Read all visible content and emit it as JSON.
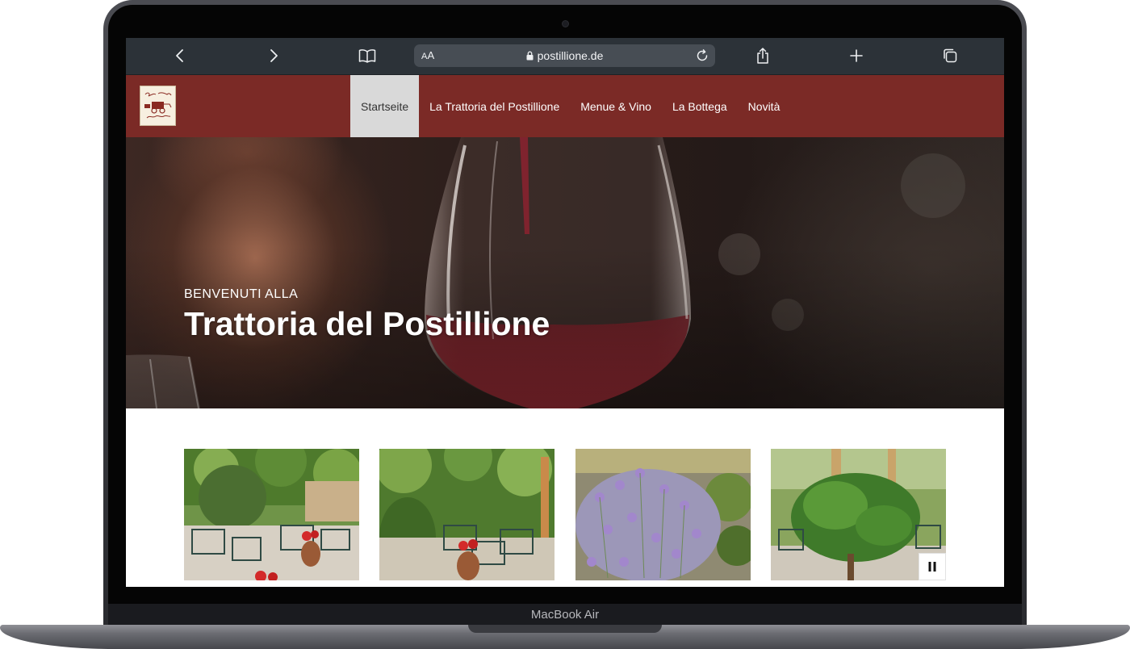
{
  "device": {
    "label": "MacBook Air"
  },
  "browser": {
    "url": "postillione.de",
    "aa_label_small": "A",
    "aa_label_big": "A"
  },
  "site": {
    "nav": [
      {
        "label": "Startseite",
        "active": true
      },
      {
        "label": "La Trattoria del Postillione",
        "active": false
      },
      {
        "label": "Menue & Vino",
        "active": false
      },
      {
        "label": "La Bottega",
        "active": false
      },
      {
        "label": "Novità",
        "active": false
      }
    ],
    "hero": {
      "kicker": "BENVENUTI ALLA",
      "title": "Trattoria del Postillione"
    }
  },
  "colors": {
    "header": "#7b2a26",
    "nav_active_bg": "#d9d9d9",
    "toolbar": "#2c3238"
  },
  "icons": {
    "back": "chevron-left-icon",
    "forward": "chevron-right-icon",
    "bookmarks": "book-icon",
    "lock": "lock-icon",
    "reload": "reload-icon",
    "share": "share-icon",
    "new_tab": "plus-icon",
    "tabs": "tabs-icon",
    "pause": "pause-icon"
  }
}
